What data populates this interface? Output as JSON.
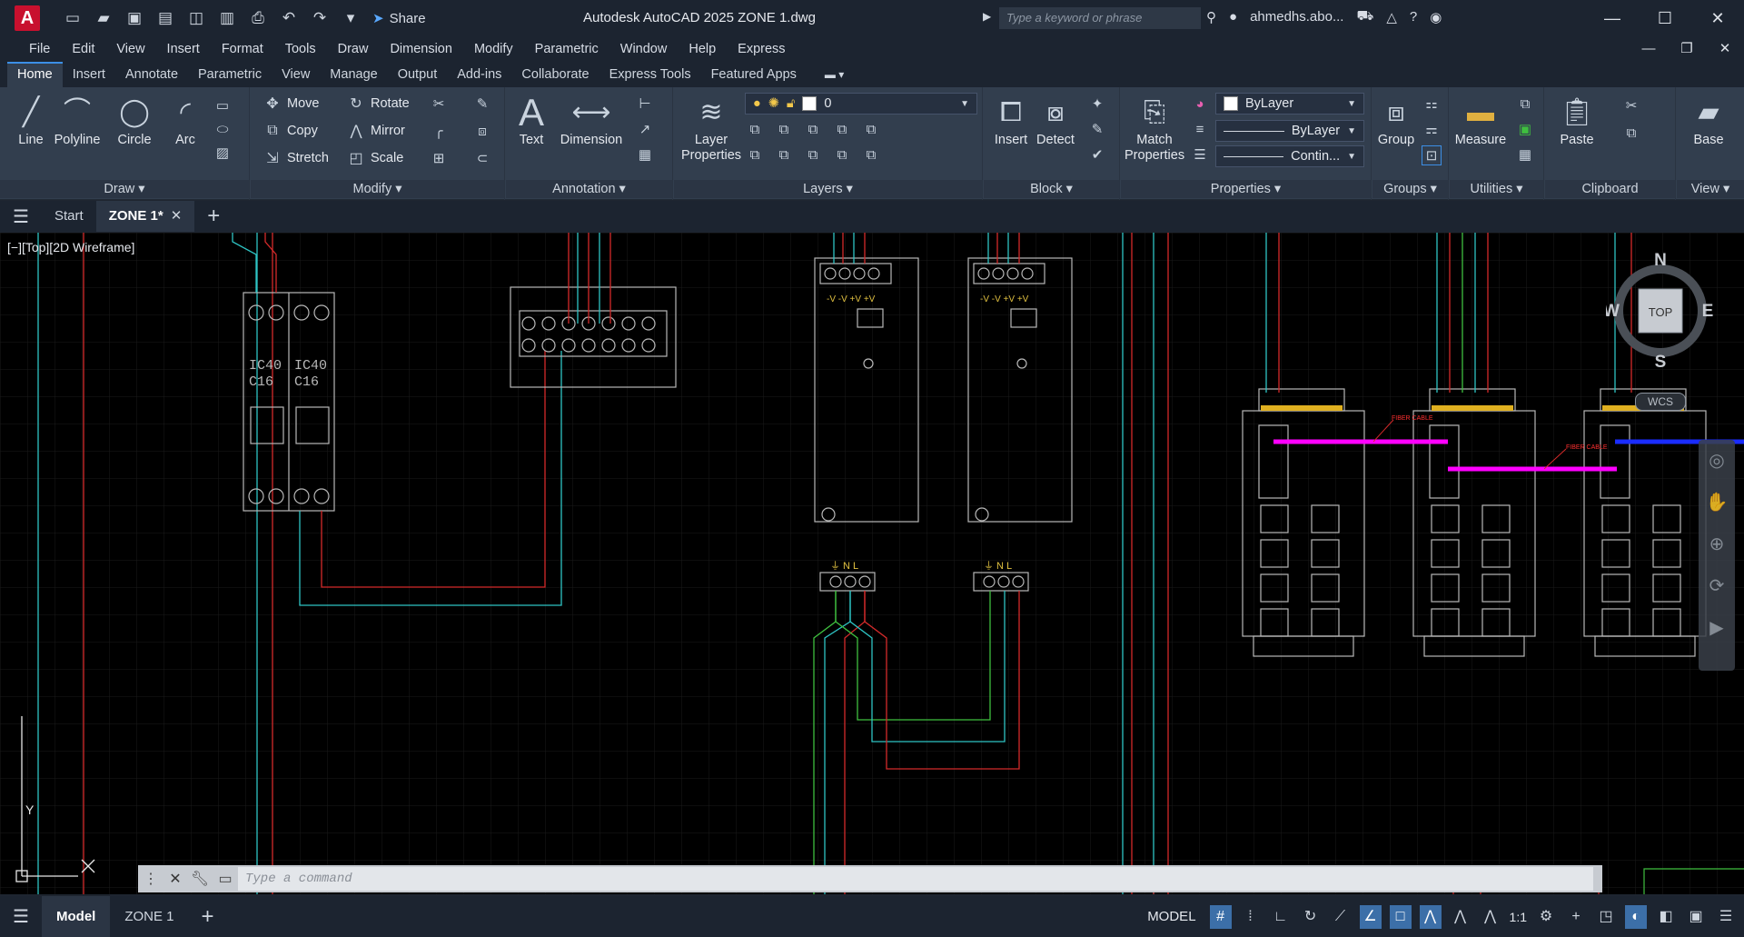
{
  "titlebar": {
    "app_logo": "A",
    "share_label": "Share",
    "title": "Autodesk AutoCAD 2025   ZONE 1.dwg",
    "search_placeholder": "Type a keyword or phrase",
    "user": "ahmedhs.abo...",
    "minimize": "—",
    "maximize": "☐",
    "close": "✕"
  },
  "menubar": {
    "items": [
      "File",
      "Edit",
      "View",
      "Insert",
      "Format",
      "Tools",
      "Draw",
      "Dimension",
      "Modify",
      "Parametric",
      "Window",
      "Help",
      "Express"
    ]
  },
  "ribbon_tabs": {
    "items": [
      "Home",
      "Insert",
      "Annotate",
      "Parametric",
      "View",
      "Manage",
      "Output",
      "Add-ins",
      "Collaborate",
      "Express Tools",
      "Featured Apps"
    ]
  },
  "ribbon": {
    "draw": {
      "title": "Draw",
      "line": "Line",
      "polyline": "Polyline",
      "circle": "Circle",
      "arc": "Arc"
    },
    "modify": {
      "title": "Modify",
      "move": "Move",
      "rotate": "Rotate",
      "copy": "Copy",
      "mirror": "Mirror",
      "stretch": "Stretch",
      "scale": "Scale"
    },
    "annotation": {
      "title": "Annotation",
      "text": "Text",
      "dimension": "Dimension"
    },
    "layers": {
      "title": "Layers",
      "layer_properties": "Layer Properties",
      "current_layer": "0"
    },
    "block": {
      "title": "Block",
      "insert": "Insert",
      "detect": "Detect"
    },
    "properties": {
      "title": "Properties",
      "match": "Match Properties",
      "color": "ByLayer",
      "lineweight": "ByLayer",
      "linetype": "Contin..."
    },
    "groups": {
      "title": "Groups",
      "group": "Group"
    },
    "utilities": {
      "title": "Utilities",
      "measure": "Measure"
    },
    "clipboard": {
      "title": "Clipboard",
      "paste": "Paste"
    },
    "view": {
      "title": "View",
      "base": "Base"
    }
  },
  "doc_tabs": {
    "start": "Start",
    "zone": "ZONE 1*"
  },
  "viewport": {
    "label": "[−][Top][2D Wireframe]",
    "breaker_1": "IC40",
    "breaker_1b": "C16",
    "breaker_2": "IC40",
    "breaker_2b": "C16",
    "psu_terminals": "-V -V +V +V",
    "psu_input": "⏚ N L",
    "fiber_label_1": "FIBER CABLE",
    "fiber_label_2": "FIBER CABLE",
    "ucs_y": "Y"
  },
  "navcube": {
    "n": "N",
    "s": "S",
    "e": "E",
    "w": "W",
    "top": "TOP",
    "wcs": "WCS"
  },
  "command": {
    "placeholder": "Type a command"
  },
  "status": {
    "model_tab": "Model",
    "layout_tab": "ZONE 1",
    "model_button": "MODEL",
    "scale": "1:1"
  },
  "colors": {
    "cyan": "#2ec4c4",
    "red": "#d42a2a",
    "green": "#3fbf3f",
    "magenta": "#ff00ff",
    "blue": "#1a2cff",
    "gray": "#9a9a9a",
    "accent": "#3c8fe6"
  }
}
